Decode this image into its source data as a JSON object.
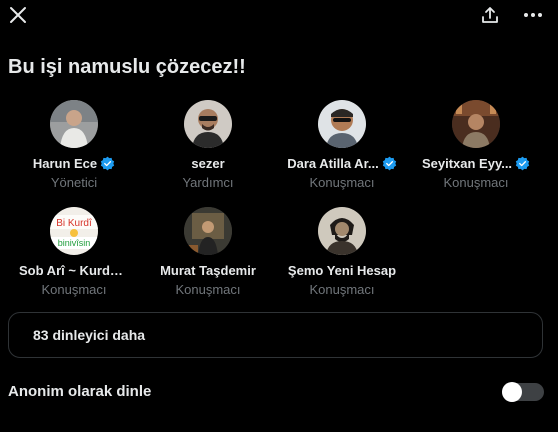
{
  "header": {
    "close_icon": "close-icon",
    "share_icon": "share-icon",
    "more_icon": "more-icon"
  },
  "space": {
    "title": "Bu işi namuslu çözecez!!"
  },
  "participants": [
    {
      "name": "Harun Ece",
      "role": "Yönetici",
      "verified": true,
      "avatar_color": "#8a8f94"
    },
    {
      "name": "sezer",
      "role": "Yardımcı",
      "verified": false,
      "avatar_color": "#7a6a5d"
    },
    {
      "name": "Dara Atilla Ar...",
      "role": "Konuşmacı",
      "verified": true,
      "avatar_color": "#9aa6b2"
    },
    {
      "name": "Seyitxan Eyy...",
      "role": "Konuşmacı",
      "verified": true,
      "avatar_color": "#5b3a2a"
    },
    {
      "name": "Sob Arî ~ KurdÊ ...",
      "role": "Konuşmacı",
      "verified": false,
      "avatar_text": [
        "Bi Kurdî",
        "binivîsin"
      ]
    },
    {
      "name": "Murat Taşdemir",
      "role": "Konuşmacı",
      "verified": false,
      "avatar_color": "#3b3a33"
    },
    {
      "name": "Şemo Yeni Hesap",
      "role": "Konuşmacı",
      "verified": false,
      "avatar_color": "#b9b3a8"
    }
  ],
  "listeners": {
    "label": "83 dinleyici daha"
  },
  "anonymous": {
    "label": "Anonim olarak dinle",
    "enabled": false
  },
  "colors": {
    "background": "#000000",
    "text_primary": "#e7e9ea",
    "text_secondary": "#71767b",
    "verified": "#1d9bf0",
    "border": "#2f3336"
  }
}
